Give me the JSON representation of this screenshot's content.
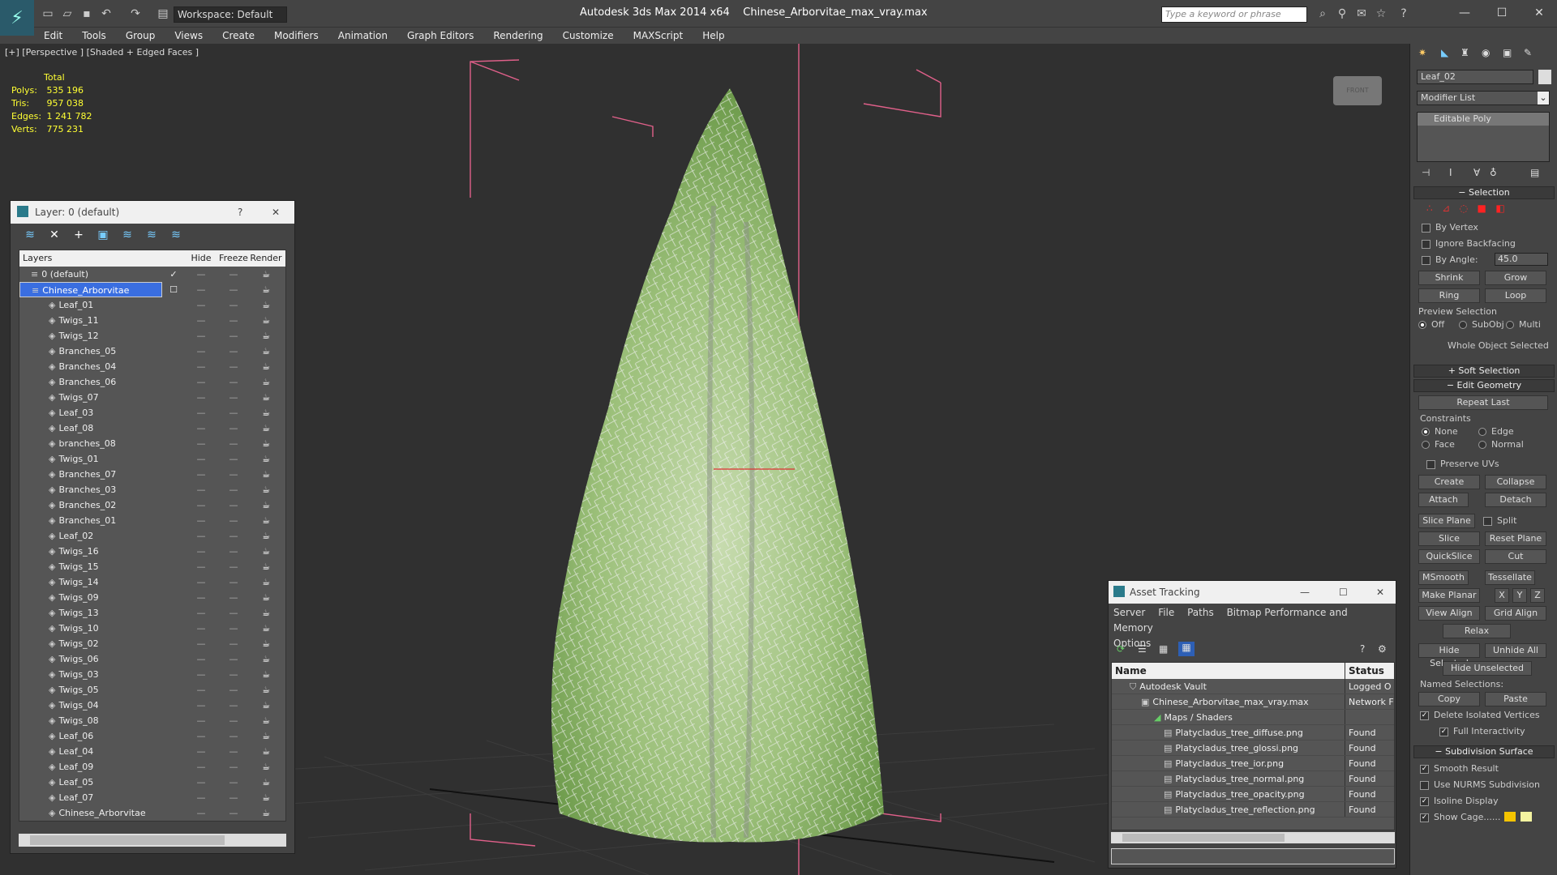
{
  "titlebar": {
    "workspace": "Workspace: Default",
    "app_title": "Autodesk 3ds Max  2014 x64",
    "file_title": "Chinese_Arborvitae_max_vray.max",
    "search_placeholder": "Type a keyword or phrase"
  },
  "menu": [
    "Edit",
    "Tools",
    "Group",
    "Views",
    "Create",
    "Modifiers",
    "Animation",
    "Graph Editors",
    "Rendering",
    "Customize",
    "MAXScript",
    "Help"
  ],
  "viewport": {
    "label": "[+] [Perspective ] [Shaded + Edged Faces ]",
    "stats_title": "Total",
    "stats": [
      {
        "label": "Polys:",
        "value": "535 196"
      },
      {
        "label": "Tris:",
        "value": "957 038"
      },
      {
        "label": "Edges:",
        "value": "1 241 782"
      },
      {
        "label": "Verts:",
        "value": "775 231"
      }
    ]
  },
  "layer_window": {
    "title": "Layer: 0 (default)",
    "help": "?",
    "col_layers": "Layers",
    "col_hide": "Hide",
    "col_freeze": "Freeze",
    "col_render": "Render",
    "rows": [
      "0 (default)",
      "Chinese_Arborvitae",
      "Leaf_01",
      "Twigs_11",
      "Twigs_12",
      "Branches_05",
      "Branches_04",
      "Branches_06",
      "Twigs_07",
      "Leaf_03",
      "Leaf_08",
      "branches_08",
      "Twigs_01",
      "Branches_07",
      "Branches_03",
      "Branches_02",
      "Branches_01",
      "Leaf_02",
      "Twigs_16",
      "Twigs_15",
      "Twigs_14",
      "Twigs_09",
      "Twigs_13",
      "Twigs_10",
      "Twigs_02",
      "Twigs_06",
      "Twigs_03",
      "Twigs_05",
      "Twigs_04",
      "Twigs_08",
      "Leaf_06",
      "Leaf_04",
      "Leaf_09",
      "Leaf_05",
      "Leaf_07",
      "Chinese_Arborvitae"
    ]
  },
  "asset_window": {
    "title": "Asset Tracking",
    "menu": [
      "Server",
      "File",
      "Paths",
      "Bitmap Performance and Memory",
      "Options"
    ],
    "col_name": "Name",
    "col_status": "Status",
    "rows": [
      {
        "name": "Autodesk Vault",
        "status": "Logged O"
      },
      {
        "name": "Chinese_Arborvitae_max_vray.max",
        "status": "Network F"
      },
      {
        "name": "Maps / Shaders",
        "status": ""
      },
      {
        "name": "Platycladus_tree_diffuse.png",
        "status": "Found"
      },
      {
        "name": "Platycladus_tree_glossi.png",
        "status": "Found"
      },
      {
        "name": "Platycladus_tree_ior.png",
        "status": "Found"
      },
      {
        "name": "Platycladus_tree_normal.png",
        "status": "Found"
      },
      {
        "name": "Platycladus_tree_opacity.png",
        "status": "Found"
      },
      {
        "name": "Platycladus_tree_reflection.png",
        "status": "Found"
      }
    ]
  },
  "command_panel": {
    "object_name": "Leaf_02",
    "modifier_list": "Modifier List",
    "stack_item": "Editable Poly",
    "selection": "Selection",
    "by_vertex": "By Vertex",
    "ignore_backfacing": "Ignore Backfacing",
    "by_angle": "By Angle:",
    "angle_value": "45.0",
    "shrink": "Shrink",
    "grow": "Grow",
    "ring": "Ring",
    "loop": "Loop",
    "preview_selection": "Preview Selection",
    "off": "Off",
    "subobj": "SubObj",
    "multi": "Multi",
    "whole_object": "Whole Object Selected",
    "soft_selection": "Soft Selection",
    "edit_geometry": "Edit Geometry",
    "repeat_last": "Repeat Last",
    "constraints": "Constraints",
    "none": "None",
    "edge": "Edge",
    "face": "Face",
    "normal": "Normal",
    "preserve_uvs": "Preserve UVs",
    "create": "Create",
    "collapse": "Collapse",
    "attach": "Attach",
    "detach": "Detach",
    "slice_plane": "Slice Plane",
    "split": "Split",
    "slice": "Slice",
    "reset_plane": "Reset Plane",
    "quickslice": "QuickSlice",
    "cut": "Cut",
    "msmooth": "MSmooth",
    "tessellate": "Tessellate",
    "make_planar": "Make Planar",
    "x": "X",
    "y": "Y",
    "z": "Z",
    "view_align": "View Align",
    "grid_align": "Grid Align",
    "relax": "Relax",
    "hide_selected": "Hide Selected",
    "unhide_all": "Unhide All",
    "hide_unselected": "Hide Unselected",
    "named_selections": "Named Selections:",
    "copy": "Copy",
    "paste": "Paste",
    "delete_isolated": "Delete Isolated Vertices",
    "full_interactivity": "Full Interactivity",
    "subdivision_surface": "Subdivision Surface",
    "smooth_result": "Smooth Result",
    "use_nurms": "Use NURMS Subdivision",
    "isoline_display": "Isoline Display",
    "show_cage": "Show Cage......",
    "viewcube_label": "FRONT"
  }
}
